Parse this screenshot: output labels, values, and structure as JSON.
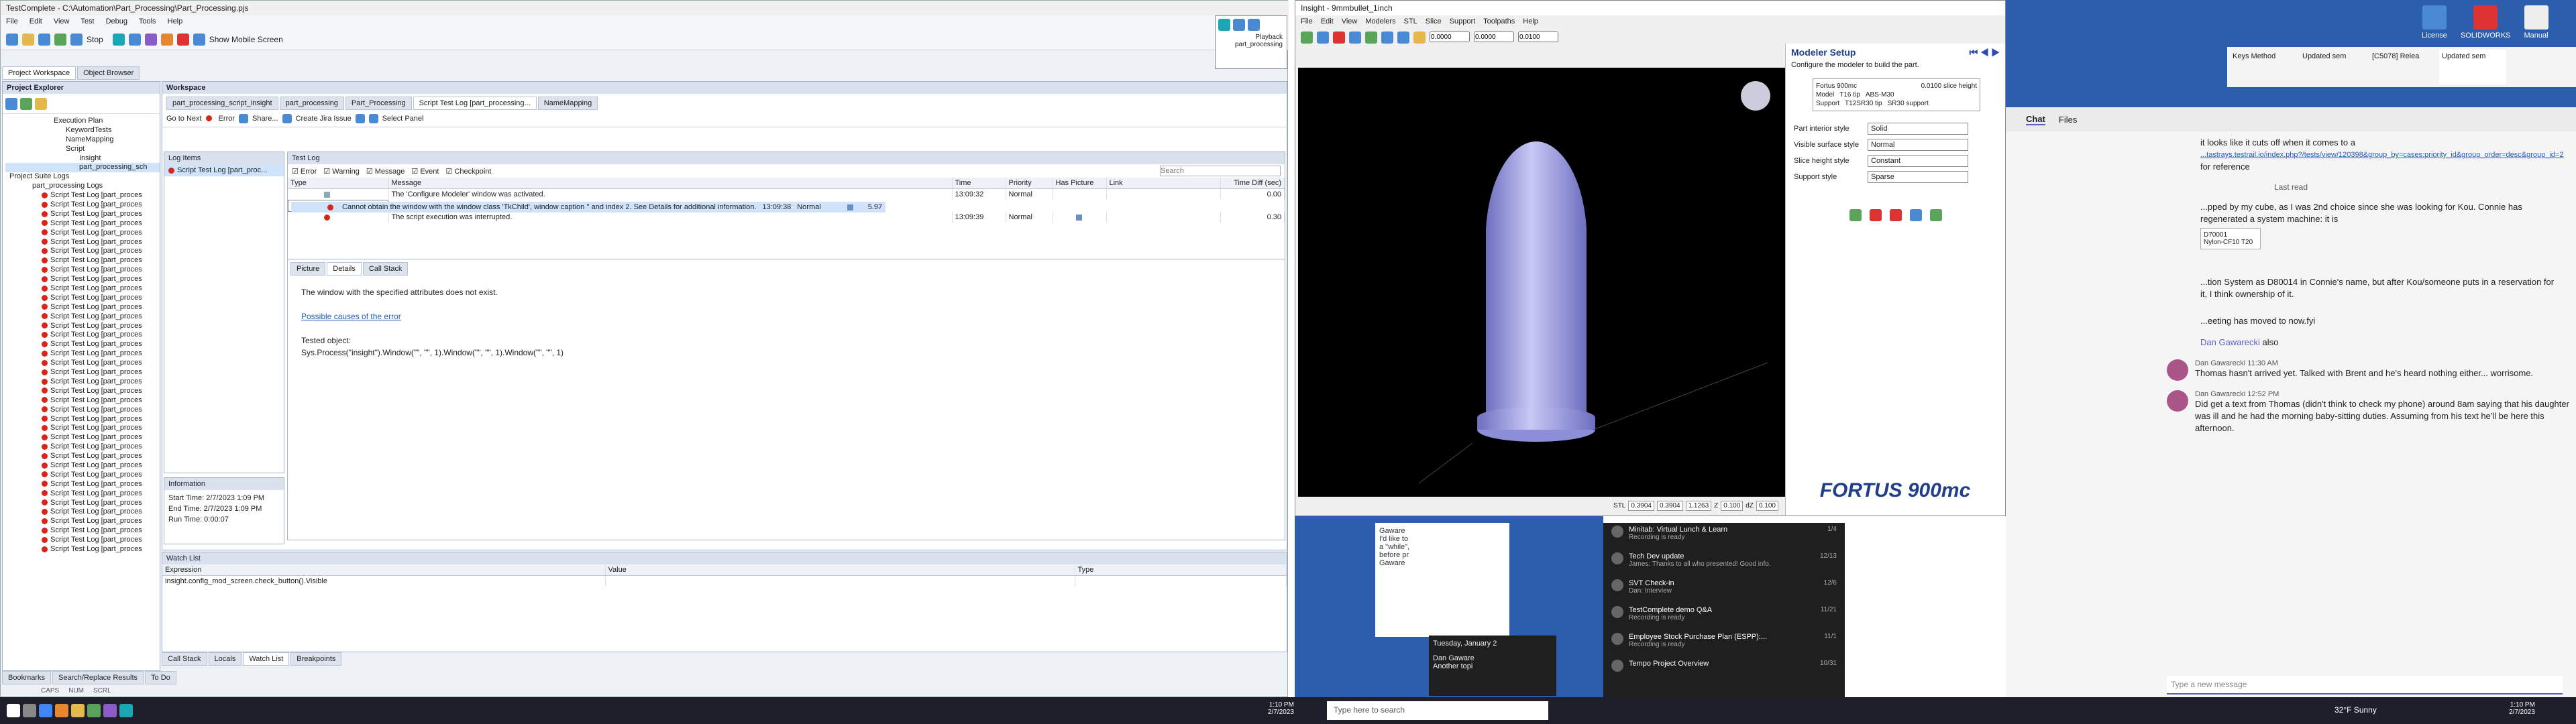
{
  "tc": {
    "title": "TestComplete - C:\\Automation\\Part_Processing\\Part_Processing.pjs",
    "menu": [
      "File",
      "Edit",
      "View",
      "Test",
      "Debug",
      "Tools",
      "Help"
    ],
    "toolbar": {
      "stop": "Stop",
      "show_mobile": "Show Mobile Screen"
    },
    "panel_tabs": [
      "Project Workspace",
      "Object Browser"
    ],
    "project_explorer": "Project Explorer",
    "tree": [
      "Execution Plan",
      "KeywordTests",
      "NameMapping",
      "Script",
      "Insight",
      "part_processing_sch",
      "Project Suite Logs",
      "part_processing Logs"
    ],
    "tree_log_item": "Script Test Log [part_proces",
    "tree_log_count": 39,
    "workspace": "Workspace",
    "ws_tabs": [
      "part_processing_script_insight",
      "part_processing",
      "Part_Processing",
      "Script Test Log [part_processing...",
      "NameMapping"
    ],
    "ws_toolbar": {
      "goto": "Go to Next",
      "error": "Error",
      "share": "Share...",
      "create_issue": "Create Jira Issue",
      "select_panel": "Select Panel"
    },
    "log_items": "Log Items",
    "log_item_row": "Script Test Log [part_proc...",
    "test_log": "Test Log",
    "filters": [
      "Error",
      "Warning",
      "Message",
      "Event",
      "Checkpoint"
    ],
    "search_placeholder": "Search",
    "log_cols": [
      "Type",
      "Message",
      "Time",
      "Priority",
      "Has Picture",
      "Link",
      "Time Diff (sec)"
    ],
    "log_rows": [
      {
        "msg": "The 'Configure Modeler' window was activated.",
        "time": "13:09:32",
        "prio": "Normal",
        "diff": "0.00"
      },
      {
        "msg": "Cannot obtain the window with the window class 'TkChild', window caption '' and index 2. See Details for additional information.",
        "time": "13:09:38",
        "prio": "Normal",
        "diff": "5.97"
      },
      {
        "msg": "The script execution was interrupted.",
        "time": "13:09:39",
        "prio": "Normal",
        "diff": "0.30"
      }
    ],
    "detail_tabs": [
      "Picture",
      "Details",
      "Call Stack"
    ],
    "detail": {
      "line1": "The window with the specified attributes does not exist.",
      "link": "Possible causes of the error",
      "tested_label": "Tested object:",
      "tested": "Sys.Process(\"insight\").Window(\"\", \"\", 1).Window(\"\", \"\", 1).Window(\"\", \"\", 1)"
    },
    "info_title": "Information",
    "info": {
      "start": "Start Time: 2/7/2023 1:09 PM",
      "end": "End Time: 2/7/2023 1:09 PM",
      "run": "Run Time: 0:00:07"
    },
    "watch": {
      "title": "Watch List",
      "cols": [
        "Expression",
        "Value",
        "Type"
      ],
      "row": "insight.config_mod_screen.check_button().Visible"
    },
    "bottom_tabs": [
      "Call Stack",
      "Locals",
      "Watch List",
      "Breakpoints"
    ],
    "status_tabs": [
      "Bookmarks",
      "Search/Replace Results",
      "To Do"
    ],
    "status": [
      "CAPS",
      "NUM",
      "SCRL"
    ]
  },
  "playback": {
    "label": "Playback",
    "item": "part_processing"
  },
  "insight": {
    "title": "Insight - 9mmbullet_1inch",
    "menu": [
      "File",
      "Edit",
      "View",
      "Modelers",
      "STL",
      "Slice",
      "Support",
      "Toolpaths",
      "Help"
    ],
    "fields": [
      "0.0000",
      "0.0000",
      "0.0100"
    ],
    "stl": {
      "label": "STL",
      "x": "0.3904",
      "y": "0.3904",
      "z": "1.1263",
      "zlabel": "Z",
      "zval": "0.100",
      "dz": "dZ",
      "dzval": "0.100"
    },
    "modeler": {
      "title": "Modeler Setup",
      "desc": "Configure the modeler to build the part.",
      "info": {
        "name": "Fortus 900mc",
        "slice": "0.0100 slice height",
        "model_label": "Model",
        "model": "T16 tip",
        "model_mat": "ABS-M30",
        "support_label": "Support",
        "support": "T12SR30 tip",
        "support_mat": "SR30 support"
      },
      "rows": [
        {
          "label": "Part interior style",
          "value": "Solid"
        },
        {
          "label": "Visible surface style",
          "value": "Normal"
        },
        {
          "label": "Slice height style",
          "value": "Constant"
        },
        {
          "label": "Support style",
          "value": "Sparse"
        }
      ],
      "brand": "FORTUS 900mc"
    }
  },
  "browser": {
    "tabs": [
      "Keys Method",
      "Updated sem",
      "[C5078] Relea",
      "Updated sem"
    ],
    "url": "...tastrays.testrail.io/index.php?/tests/view/120398&group_by=cases:priority_id&group_order=desc&group_id=2"
  },
  "desktop": {
    "icons": [
      "License",
      "SOLIDWORKS",
      "Manual"
    ]
  },
  "teams": {
    "tabs": [
      "Chat",
      "Files"
    ],
    "snip": "it looks like it cuts off when it comes to a",
    "url_text": "...tastrays.testrail.io/index.php?/tests/view/120398&group_by=cases:priority_id&group_order=desc&group_id=2",
    "for_ref": "for reference",
    "lastread": "Last read",
    "m1": "...pped by my cube, as I was 2nd choice since she was looking for Kou.  Connie has regenerated a system machine:  it is",
    "badge1": "D70001",
    "badge2": "Nylon-CF10 T20",
    "m2": "...tion System as D80014 in Connie's name, but after Kou/someone puts in a reservation for it, I think ownership of it.",
    "m3": "...eeting has moved to now.fyi",
    "mention": "Dan Gawarecki",
    "also": "also",
    "a1": {
      "name": "Dan Gawarecki",
      "time": "11:30 AM",
      "text": "Thomas hasn't arrived yet.  Talked with Brent and he's heard nothing either... worrisome."
    },
    "a2": {
      "name": "Dan Gawarecki",
      "time": "12:52 PM",
      "text": "Did get a text from Thomas (didn't think to check my phone) around 8am saying that his daughter was ill and he had the morning baby-sitting duties.  Assuming from his text he'll be here this afternoon."
    },
    "compose": "Type a new message",
    "chats": [
      {
        "title": "Minitab: Virtual Lunch & Learn",
        "sub": "Recording is ready",
        "date": "1/4"
      },
      {
        "title": "Tech Dev update",
        "sub": "James: Thanks to all who presented! Good info.",
        "date": "12/13"
      },
      {
        "title": "SVT Check-in",
        "sub": "Dan: Interview",
        "date": "12/6"
      },
      {
        "title": "TestComplete demo Q&A",
        "sub": "Recording is ready",
        "date": "11/21"
      },
      {
        "title": "Employee Stock Purchase Plan (ESPP):...",
        "sub": "Recording is ready",
        "date": "11/1"
      },
      {
        "title": "Tempo Project Overview",
        "sub": "",
        "date": "10/31"
      }
    ],
    "outlook": {
      "name": "Gaware",
      "snips": [
        "I'd like to",
        "a \"while\",",
        "before pr",
        "Gaware"
      ],
      "date": "Tuesday, January 2",
      "n2": "Dan Gaware",
      "n2sub": "Another topi"
    }
  },
  "taskbar": {
    "search": "Type here to search",
    "weather": "32°F  Sunny",
    "time": "1:10 PM",
    "date": "2/7/2023",
    "time2": "1:10 PM",
    "date2": "2/7/2023"
  }
}
